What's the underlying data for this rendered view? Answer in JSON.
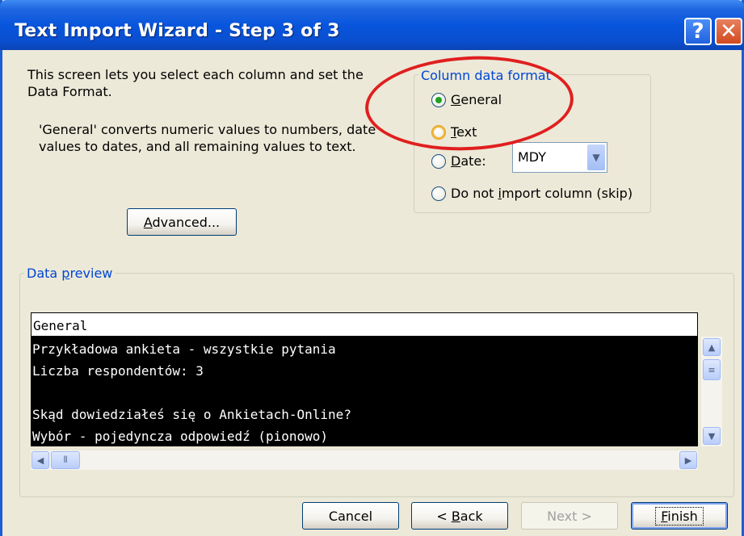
{
  "window": {
    "title": "Text Import Wizard - Step 3 of 3",
    "help_glyph": "?",
    "close_glyph": "✕"
  },
  "intro_text": "This screen lets you select each column and set the Data Format.",
  "general_desc": "'General' converts numeric values to numbers, date values to dates, and all remaining values to text.",
  "advanced_button": {
    "label_pre": "",
    "label_u": "A",
    "label_post": "dvanced..."
  },
  "column_format": {
    "title": "Column data format",
    "options": [
      {
        "label_u": "G",
        "label_post": "eneral",
        "checked": true
      },
      {
        "label_u": "T",
        "label_post": "ext",
        "checked": false
      },
      {
        "label_u": "D",
        "label_post": "ate:",
        "checked": false
      },
      {
        "label_pre": "Do not ",
        "label_u": "i",
        "label_post": "mport column (skip)",
        "checked": false
      }
    ],
    "date_format_value": "MDY"
  },
  "data_preview": {
    "title_pre": "Data ",
    "title_u": "p",
    "title_post": "review",
    "header": "General",
    "lines": [
      "Przykładowa ankieta - wszystkie pytania",
      "Liczba respondentów: 3",
      "",
      "Skąd dowiedziałeś się o Ankietach-Online?",
      "Wybór - pojedyncza odpowiedź (pionowo)"
    ]
  },
  "buttons": {
    "cancel": "Cancel",
    "back_pre": "< ",
    "back_u": "B",
    "back_post": "ack",
    "next": "Next >",
    "finish_u": "F",
    "finish_post": "inish"
  },
  "colors": {
    "titlebar": "#0855dd",
    "dialog_bg": "#ece9d8",
    "group_title": "#0046d5",
    "annotation": "#e01f1f"
  }
}
